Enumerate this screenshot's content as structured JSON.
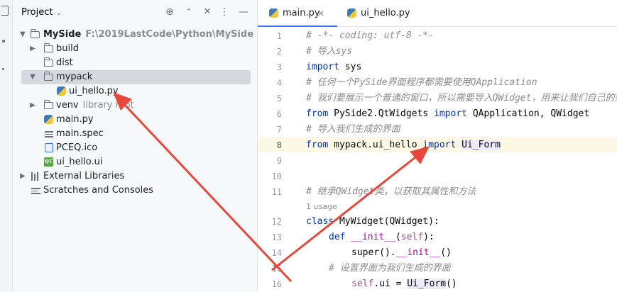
{
  "project_panel": {
    "title": "Project",
    "tree": [
      {
        "name": "MySide",
        "hint": "F:\\2019LastCode\\Python\\MySide"
      },
      {
        "name": "build"
      },
      {
        "name": "dist"
      },
      {
        "name": "mypack"
      },
      {
        "name": "ui_hello.py"
      },
      {
        "name": "venv",
        "hint": "library root"
      },
      {
        "name": "main.py"
      },
      {
        "name": "main.spec"
      },
      {
        "name": "PCEQ.ico"
      },
      {
        "name": "ui_hello.ui"
      },
      {
        "name": "External Libraries"
      },
      {
        "name": "Scratches and Consoles"
      }
    ]
  },
  "tabs": [
    {
      "label": "main.py"
    },
    {
      "label": "ui_hello.py"
    }
  ],
  "editor": {
    "line_numbers": [
      "1",
      "2",
      "3",
      "4",
      "5",
      "6",
      "7",
      "8",
      "9",
      "10",
      "11",
      "12",
      "13",
      "14",
      "15",
      "16"
    ],
    "usage_hint": "1 usage",
    "lines": {
      "l1": "# -*- coding: utf-8 -*-",
      "l2": "# 导入sys",
      "l3_kw": "import",
      "l3_rest": " sys",
      "l4": "# 任何一个PySide界面程序都需要使用QApplication",
      "l5": "# 我们要展示一个普通的窗口，所以需要导入QWidget，用来让我们自己的类继承",
      "l6_kw1": "from",
      "l6_mod": " PySide2.QtWidgets ",
      "l6_kw2": "import",
      "l6_rest": " QApplication, QWidget",
      "l7": "# 导入我们生成的界面",
      "l8_kw1": "from",
      "l8_mod": " mypack.ui_hello ",
      "l8_kw2": "import",
      "l8_sp": " ",
      "l8_rest": "Ui_Form",
      "l11": "# 继承QWidget类，以获取其属性和方法",
      "l12_kw": "class",
      "l12_rest": " MyWidget(QWidget):",
      "l13_kw": "def",
      "l13_mg": "__init__",
      "l13_p1": "(",
      "l13_self": "self",
      "l13_p2": "):",
      "l14_a": "super().",
      "l14_mg": "__init__",
      "l14_b": "()",
      "l15": "# 设置界面为我们生成的界面",
      "l16_self": "self",
      "l16_a": ".ui = ",
      "l16_b": "Ui_Form",
      "l16_c": "()"
    }
  },
  "colors": {
    "keyword": "#0033b3",
    "comment": "#8c8c8c",
    "annotation_arrow": "#e8483c",
    "selection": "#d5d8de",
    "current_line": "#fdf7e5"
  }
}
